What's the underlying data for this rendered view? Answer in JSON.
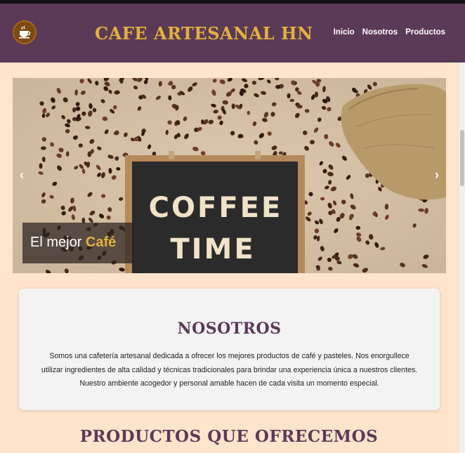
{
  "header": {
    "logo_icon": "coffee-cup-icon",
    "brand": "CAFE ARTESANAL HN",
    "nav": [
      "Inicio",
      "Nosotros",
      "Productos"
    ]
  },
  "carousel": {
    "chalkboard_text_line1": "COFFEE",
    "chalkboard_text_line2": "TIME",
    "caption_prefix": "El mejor",
    "caption_highlight": "Café",
    "prev_icon": "chevron-left-icon",
    "next_icon": "chevron-right-icon"
  },
  "about": {
    "title": "NOSOTROS",
    "text": "Somos una cafetería artesanal dedicada a ofrecer los mejores productos de café y pasteles. Nos enorgullece utilizar ingredientes de alta calidad y técnicas tradicionales para brindar una experiencia única a nuestros clientes. Nuestro ambiente acogedor y personal amable hacen de cada visita un momento especial."
  },
  "products": {
    "title": "PRODUCTOS QUE OFRECEMOS"
  },
  "colors": {
    "header_bg": "#5b3a58",
    "brand_gold": "#e2b13c",
    "page_bg": "#fde4cb",
    "card_bg": "#f3f3f3"
  }
}
